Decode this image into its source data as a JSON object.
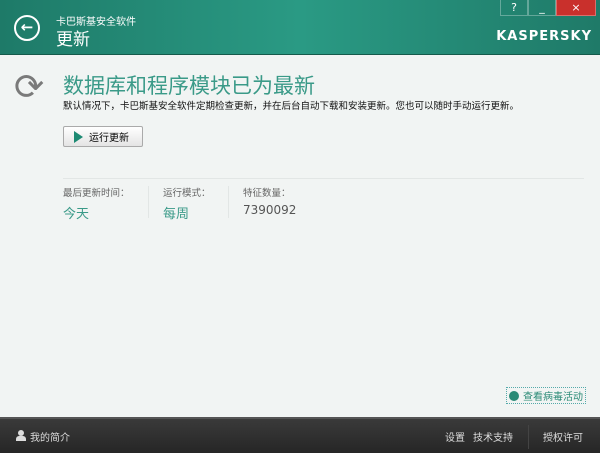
{
  "header": {
    "app_name": "卡巴斯基安全软件",
    "section": "更新",
    "logo": "KASPERSKY",
    "buttons": {
      "help": "?",
      "minimize": "_",
      "close": "×"
    }
  },
  "main": {
    "title": "数据库和程序模块已为最新",
    "description": "默认情况下，卡巴斯基安全软件定期检查更新，并在后台自动下载和安装更新。您也可以随时手动运行更新。",
    "run_update": "运行更新",
    "stats": [
      {
        "label": "最后更新时间：",
        "value": "今天"
      },
      {
        "label": "运行模式：",
        "value": "每周"
      },
      {
        "label": "特征数量：",
        "value": "7390092"
      }
    ],
    "virus_activity": "查看病毒活动"
  },
  "footer": {
    "profile": "我的简介",
    "settings": "设置",
    "support": "技术支持",
    "license": "授权许可"
  }
}
